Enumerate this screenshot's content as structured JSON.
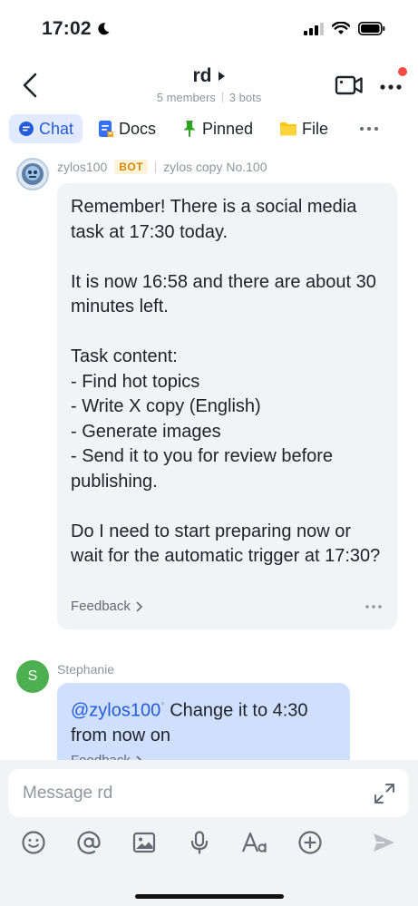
{
  "status_bar": {
    "time": "17:02"
  },
  "header": {
    "title": "rd",
    "members": "5 members",
    "bots": "3 bots"
  },
  "tabs": [
    {
      "label": "Chat",
      "icon": "chat-bubble-icon",
      "active": true
    },
    {
      "label": "Docs",
      "icon": "docs-icon"
    },
    {
      "label": "Pinned",
      "icon": "pin-icon"
    },
    {
      "label": "File",
      "icon": "folder-icon"
    }
  ],
  "messages": [
    {
      "sender": "zylos100",
      "badge": "BOT",
      "bot_name": "zylos copy No.100",
      "text": "Remember! There is a social media task at 17:30 today.\n\nIt is now 16:58 and there are about 30 minutes left.\n\nTask content:\n- Find hot topics\n- Write X copy (English)\n- Generate images\n- Send it to you for review before publishing.\n\nDo I need to start preparing now or wait for the automatic trigger at 17:30?",
      "feedback": "Feedback"
    },
    {
      "sender": "Stephanie",
      "avatar_letter": "S",
      "mention": "@zylos100",
      "text": " Change it to 4:30 from now on",
      "feedback": "Feedback"
    }
  ],
  "composer": {
    "placeholder": "Message rd"
  },
  "toolbar_icons": [
    "emoji-icon",
    "mention-icon",
    "image-icon",
    "microphone-icon",
    "font-icon",
    "plus-icon",
    "send-icon"
  ],
  "colors": {
    "accent": "#245bdb",
    "active_tab_bg": "#e1eaff",
    "bot_bubble": "#f2f3f5",
    "user_bubble": "#cfe0ff",
    "notification": "#f54a45",
    "avatar_green": "#4caf50"
  }
}
